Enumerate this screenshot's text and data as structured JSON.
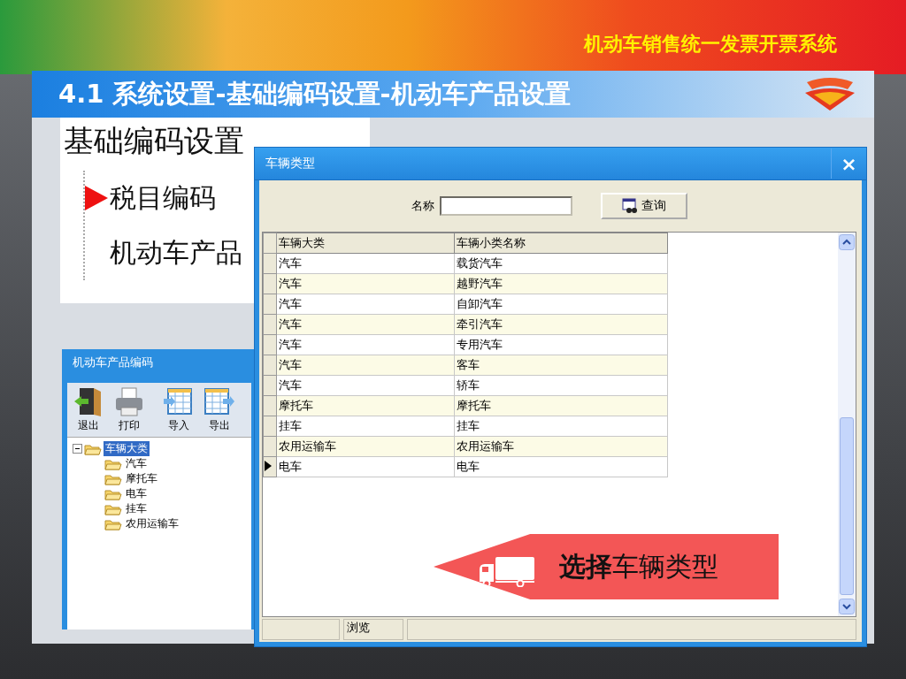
{
  "slide": {
    "header": "机动车销售统一发票开票系统",
    "title": "4.1 系统设置-基础编码设置-机动车产品设置"
  },
  "menu_snapshot": {
    "heading": "基础编码设置",
    "items": [
      {
        "label": "税目编码",
        "marked": true
      },
      {
        "label": "机动车产品",
        "marked": false
      }
    ]
  },
  "product_window": {
    "title": "机动车产品编码",
    "toolbar": [
      {
        "label": "退出",
        "kind": "exit"
      },
      {
        "label": "打印",
        "kind": "print"
      },
      {
        "label": "导入",
        "kind": "import"
      },
      {
        "label": "导出",
        "kind": "export"
      }
    ],
    "tree": [
      {
        "label": "车辆大类",
        "selected": true,
        "expanded": true,
        "children": [
          {
            "label": "汽车",
            "selected": false
          },
          {
            "label": "摩托车",
            "selected": false
          },
          {
            "label": "电车",
            "selected": false
          },
          {
            "label": "挂车",
            "selected": false
          },
          {
            "label": "农用运输车",
            "selected": false
          }
        ]
      }
    ]
  },
  "dialog": {
    "title": "车辆类型",
    "close": "×",
    "search": {
      "label": "名称",
      "button": "查询"
    },
    "table": {
      "columns": [
        "车辆大类",
        "车辆小类名称"
      ],
      "rows": [
        {
          "cells": [
            "汽车",
            "载货汽车"
          ],
          "current": false
        },
        {
          "cells": [
            "汽车",
            "越野汽车"
          ],
          "current": false
        },
        {
          "cells": [
            "汽车",
            "自卸汽车"
          ],
          "current": false
        },
        {
          "cells": [
            "汽车",
            "牵引汽车"
          ],
          "current": false
        },
        {
          "cells": [
            "汽车",
            "专用汽车"
          ],
          "current": false
        },
        {
          "cells": [
            "汽车",
            "客车"
          ],
          "current": false
        },
        {
          "cells": [
            "汽车",
            "轿车"
          ],
          "current": false
        },
        {
          "cells": [
            "摩托车",
            "摩托车"
          ],
          "current": false
        },
        {
          "cells": [
            "挂车",
            "挂车"
          ],
          "current": false
        },
        {
          "cells": [
            "农用运输车",
            "农用运输车"
          ],
          "current": false
        },
        {
          "cells": [
            "电车",
            "电车"
          ],
          "current": true
        }
      ]
    },
    "status_bar": {
      "mode": "浏览"
    }
  },
  "callout": "**选择**车辆类型"
}
